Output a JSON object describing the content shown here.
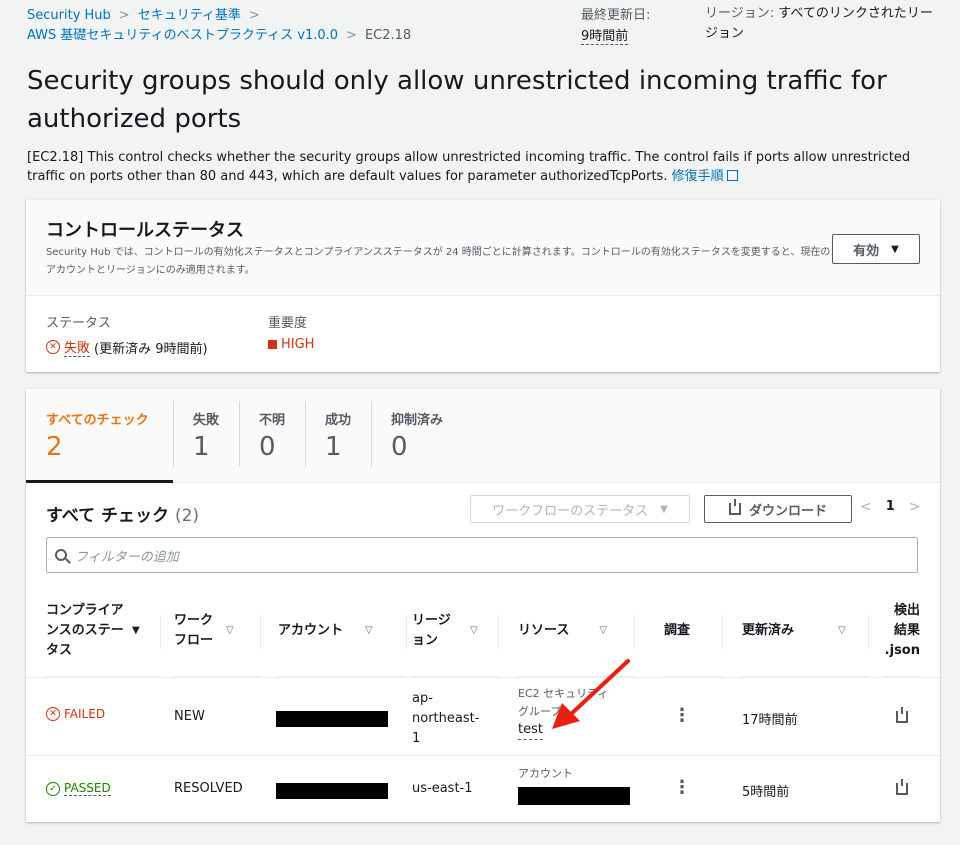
{
  "breadcrumb": {
    "items": [
      "Security Hub",
      "セキュリティ基準",
      "AWS 基礎セキュリティのベストプラクティス v1.0.0",
      "EC2.18"
    ]
  },
  "meta": {
    "last_updated_label": "最終更新日:",
    "last_updated_value": "9時間前",
    "region_label": "リージョン:",
    "region_value": "すべてのリンクされたリージョン"
  },
  "page": {
    "title": "Security groups should only allow unrestricted incoming traffic for authorized ports",
    "description": "[EC2.18] This control checks whether the security groups allow unrestricted incoming traffic. The control fails if ports allow unrestricted traffic on ports other than 80 and 443, which are default values for parameter authorizedTcpPorts.",
    "remediation_link": "修復手順"
  },
  "control_status": {
    "title": "コントロールステータス",
    "subtitle": "Security Hub では、コントロールの有効化ステータスとコンプライアンスステータスが 24 時間ごとに計算されます。コントロールの有効化ステータスを変更すると、現在のアカウントとリージョンにのみ適用されます。",
    "enabled_dropdown": "有効",
    "status_label": "ステータス",
    "status_value": "失敗",
    "status_note": "(更新済み 9時間前)",
    "severity_label": "重要度",
    "severity_value": "HIGH"
  },
  "tabs": [
    {
      "label": "すべてのチェック",
      "count": "2"
    },
    {
      "label": "失敗",
      "count": "1"
    },
    {
      "label": "不明",
      "count": "0"
    },
    {
      "label": "成功",
      "count": "1"
    },
    {
      "label": "抑制済み",
      "count": "0"
    }
  ],
  "checks": {
    "title": "すべて チェック",
    "count": "(2)",
    "workflow_dropdown": "ワークフローのステータス",
    "download_button": "ダウンロード",
    "page_number": "1",
    "filter_placeholder": "フィルターの追加",
    "columns": {
      "compliance": "コンプライアンスのステータス",
      "workflow": "ワークフロー",
      "account": "アカウント",
      "region": "リージョン",
      "resource": "リソース",
      "investigate": "調査",
      "updated": "更新済み",
      "json": "検出結果 .json"
    },
    "rows": [
      {
        "status": "FAILED",
        "workflow": "NEW",
        "region": "ap-northeast-1",
        "resource_type": "EC2 セキュリティグループ",
        "resource": "test",
        "updated": "17時間前"
      },
      {
        "status": "PASSED",
        "workflow": "RESOLVED",
        "region": "us-east-1",
        "resource_type": "アカウント",
        "resource": "",
        "updated": "5時間前"
      }
    ]
  },
  "colors": {
    "link": "#0073bb",
    "active_tab": "#ec7211",
    "failed": "#d13212",
    "passed": "#1d8102",
    "arrow": "#e8200f"
  },
  "icons": [
    "external-link-icon",
    "failed-icon",
    "passed-icon",
    "severity-square-icon",
    "download-icon",
    "search-icon",
    "kebab-icon",
    "annotation-arrow"
  ]
}
